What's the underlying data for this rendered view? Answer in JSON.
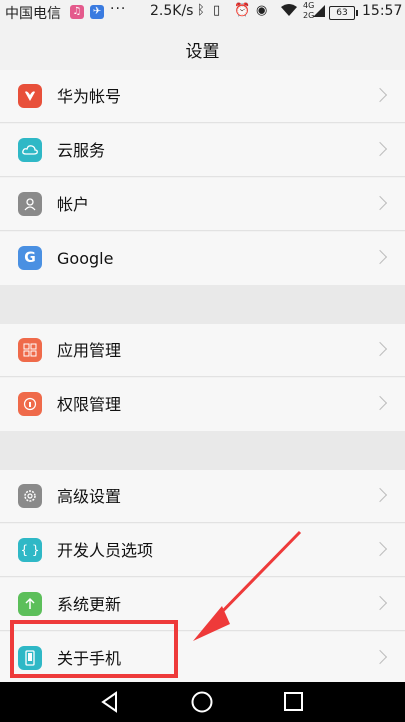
{
  "status_bar": {
    "carrier": "中国电信",
    "more_indicator": "···",
    "network_speed": "2.5K/s",
    "network_type": "4G",
    "network_type_2": "2G",
    "battery_level": "63",
    "time": "15:57"
  },
  "header": {
    "title": "设置"
  },
  "groups": [
    {
      "items": [
        {
          "label": "华为帐号",
          "icon": "huawei-icon",
          "color": "#e8503a"
        },
        {
          "label": "云服务",
          "icon": "cloud-icon",
          "color": "#2fb8c6"
        },
        {
          "label": "帐户",
          "icon": "person-icon",
          "color": "#8a8a8a"
        },
        {
          "label": "Google",
          "icon": "google-icon",
          "color": "#4a90e2"
        }
      ]
    },
    {
      "items": [
        {
          "label": "应用管理",
          "icon": "apps-icon",
          "color": "#ef6a4a"
        },
        {
          "label": "权限管理",
          "icon": "permission-icon",
          "color": "#ef6a4a"
        }
      ]
    },
    {
      "items": [
        {
          "label": "高级设置",
          "icon": "gear-icon",
          "color": "#8a8a8a"
        },
        {
          "label": "开发人员选项",
          "icon": "developer-icon",
          "color": "#2fb8c6"
        },
        {
          "label": "系统更新",
          "icon": "update-icon",
          "color": "#5cbf5a"
        },
        {
          "label": "关于手机",
          "icon": "phone-icon",
          "color": "#2fb8c6"
        }
      ]
    }
  ],
  "annotation": {
    "color": "#ee3a3a"
  },
  "nav_bar": {
    "back": "back-icon",
    "home": "home-icon",
    "recents": "recents-icon"
  }
}
